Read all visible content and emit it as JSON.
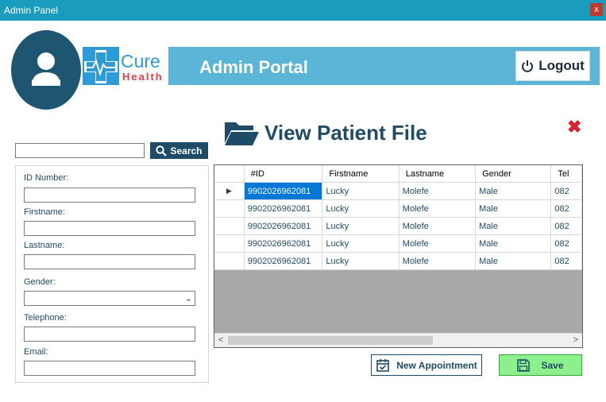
{
  "window": {
    "title": "Admin Panel",
    "close_glyph": "x"
  },
  "branding": {
    "logo_cure": "Cure",
    "logo_health": "Health",
    "avatar_icon": "user-icon"
  },
  "header": {
    "title": "Admin Portal",
    "logout_label": "Logout",
    "logout_icon": "power-icon"
  },
  "page": {
    "title": "View Patient File",
    "title_icon": "folder-open-icon",
    "close_icon": "close-icon",
    "close_glyph": "✖"
  },
  "search": {
    "value": "",
    "placeholder": "",
    "button_label": "Search"
  },
  "form": {
    "id_label": "ID Number:",
    "firstname_label": "Firstname:",
    "lastname_label": "Lastname:",
    "gender_label": "Gender:",
    "telephone_label": "Telephone:",
    "email_label": "Email:",
    "id_value": "",
    "firstname_value": "",
    "lastname_value": "",
    "gender_value": "",
    "telephone_value": "",
    "email_value": ""
  },
  "grid": {
    "columns": [
      "#ID",
      "Firstname",
      "Lastname",
      "Gender",
      "Tel"
    ],
    "rows": [
      [
        "9902026962081",
        "Lucky",
        "Molefe",
        "Male",
        "082"
      ],
      [
        "9902026962081",
        "Lucky",
        "Molefe",
        "Male",
        "082"
      ],
      [
        "9902026962081",
        "Lucky",
        "Molefe",
        "Male",
        "082"
      ],
      [
        "9902026962081",
        "Lucky",
        "Molefe",
        "Male",
        "082"
      ],
      [
        "9902026962081",
        "Lucky",
        "Molefe",
        "Male",
        "082"
      ]
    ],
    "current_row_marker": "▶",
    "scroll_left": "<",
    "scroll_right": ">"
  },
  "actions": {
    "new_appointment": "New Appointment",
    "save": "Save"
  },
  "colors": {
    "titlebar": "#1a9cbf",
    "banner": "#5bb5d6",
    "navy": "#1e4b66",
    "save_green": "#8cf08c",
    "close_red": "#d9232e",
    "selection": "#0078d7"
  }
}
